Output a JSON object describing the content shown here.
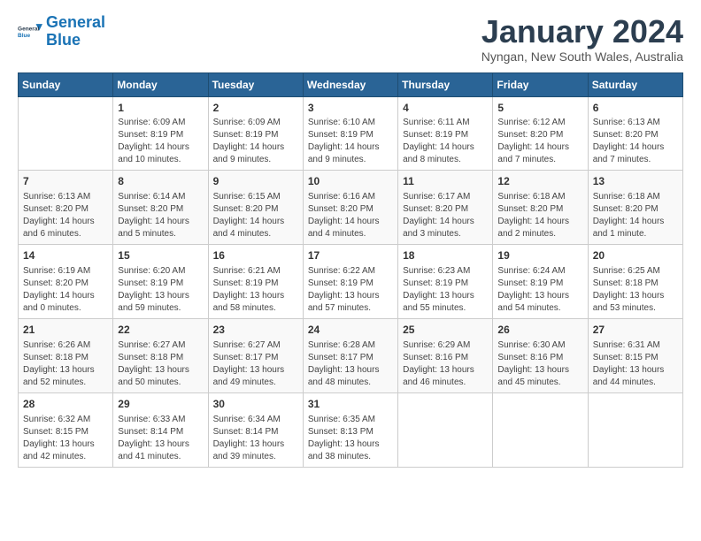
{
  "logo": {
    "line1": "General",
    "line2": "Blue"
  },
  "title": "January 2024",
  "location": "Nyngan, New South Wales, Australia",
  "weekdays": [
    "Sunday",
    "Monday",
    "Tuesday",
    "Wednesday",
    "Thursday",
    "Friday",
    "Saturday"
  ],
  "weeks": [
    [
      {
        "day": "",
        "info": ""
      },
      {
        "day": "1",
        "info": "Sunrise: 6:09 AM\nSunset: 8:19 PM\nDaylight: 14 hours\nand 10 minutes."
      },
      {
        "day": "2",
        "info": "Sunrise: 6:09 AM\nSunset: 8:19 PM\nDaylight: 14 hours\nand 9 minutes."
      },
      {
        "day": "3",
        "info": "Sunrise: 6:10 AM\nSunset: 8:19 PM\nDaylight: 14 hours\nand 9 minutes."
      },
      {
        "day": "4",
        "info": "Sunrise: 6:11 AM\nSunset: 8:19 PM\nDaylight: 14 hours\nand 8 minutes."
      },
      {
        "day": "5",
        "info": "Sunrise: 6:12 AM\nSunset: 8:20 PM\nDaylight: 14 hours\nand 7 minutes."
      },
      {
        "day": "6",
        "info": "Sunrise: 6:13 AM\nSunset: 8:20 PM\nDaylight: 14 hours\nand 7 minutes."
      }
    ],
    [
      {
        "day": "7",
        "info": "Sunrise: 6:13 AM\nSunset: 8:20 PM\nDaylight: 14 hours\nand 6 minutes."
      },
      {
        "day": "8",
        "info": "Sunrise: 6:14 AM\nSunset: 8:20 PM\nDaylight: 14 hours\nand 5 minutes."
      },
      {
        "day": "9",
        "info": "Sunrise: 6:15 AM\nSunset: 8:20 PM\nDaylight: 14 hours\nand 4 minutes."
      },
      {
        "day": "10",
        "info": "Sunrise: 6:16 AM\nSunset: 8:20 PM\nDaylight: 14 hours\nand 4 minutes."
      },
      {
        "day": "11",
        "info": "Sunrise: 6:17 AM\nSunset: 8:20 PM\nDaylight: 14 hours\nand 3 minutes."
      },
      {
        "day": "12",
        "info": "Sunrise: 6:18 AM\nSunset: 8:20 PM\nDaylight: 14 hours\nand 2 minutes."
      },
      {
        "day": "13",
        "info": "Sunrise: 6:18 AM\nSunset: 8:20 PM\nDaylight: 14 hours\nand 1 minute."
      }
    ],
    [
      {
        "day": "14",
        "info": "Sunrise: 6:19 AM\nSunset: 8:20 PM\nDaylight: 14 hours\nand 0 minutes."
      },
      {
        "day": "15",
        "info": "Sunrise: 6:20 AM\nSunset: 8:19 PM\nDaylight: 13 hours\nand 59 minutes."
      },
      {
        "day": "16",
        "info": "Sunrise: 6:21 AM\nSunset: 8:19 PM\nDaylight: 13 hours\nand 58 minutes."
      },
      {
        "day": "17",
        "info": "Sunrise: 6:22 AM\nSunset: 8:19 PM\nDaylight: 13 hours\nand 57 minutes."
      },
      {
        "day": "18",
        "info": "Sunrise: 6:23 AM\nSunset: 8:19 PM\nDaylight: 13 hours\nand 55 minutes."
      },
      {
        "day": "19",
        "info": "Sunrise: 6:24 AM\nSunset: 8:19 PM\nDaylight: 13 hours\nand 54 minutes."
      },
      {
        "day": "20",
        "info": "Sunrise: 6:25 AM\nSunset: 8:18 PM\nDaylight: 13 hours\nand 53 minutes."
      }
    ],
    [
      {
        "day": "21",
        "info": "Sunrise: 6:26 AM\nSunset: 8:18 PM\nDaylight: 13 hours\nand 52 minutes."
      },
      {
        "day": "22",
        "info": "Sunrise: 6:27 AM\nSunset: 8:18 PM\nDaylight: 13 hours\nand 50 minutes."
      },
      {
        "day": "23",
        "info": "Sunrise: 6:27 AM\nSunset: 8:17 PM\nDaylight: 13 hours\nand 49 minutes."
      },
      {
        "day": "24",
        "info": "Sunrise: 6:28 AM\nSunset: 8:17 PM\nDaylight: 13 hours\nand 48 minutes."
      },
      {
        "day": "25",
        "info": "Sunrise: 6:29 AM\nSunset: 8:16 PM\nDaylight: 13 hours\nand 46 minutes."
      },
      {
        "day": "26",
        "info": "Sunrise: 6:30 AM\nSunset: 8:16 PM\nDaylight: 13 hours\nand 45 minutes."
      },
      {
        "day": "27",
        "info": "Sunrise: 6:31 AM\nSunset: 8:15 PM\nDaylight: 13 hours\nand 44 minutes."
      }
    ],
    [
      {
        "day": "28",
        "info": "Sunrise: 6:32 AM\nSunset: 8:15 PM\nDaylight: 13 hours\nand 42 minutes."
      },
      {
        "day": "29",
        "info": "Sunrise: 6:33 AM\nSunset: 8:14 PM\nDaylight: 13 hours\nand 41 minutes."
      },
      {
        "day": "30",
        "info": "Sunrise: 6:34 AM\nSunset: 8:14 PM\nDaylight: 13 hours\nand 39 minutes."
      },
      {
        "day": "31",
        "info": "Sunrise: 6:35 AM\nSunset: 8:13 PM\nDaylight: 13 hours\nand 38 minutes."
      },
      {
        "day": "",
        "info": ""
      },
      {
        "day": "",
        "info": ""
      },
      {
        "day": "",
        "info": ""
      }
    ]
  ]
}
